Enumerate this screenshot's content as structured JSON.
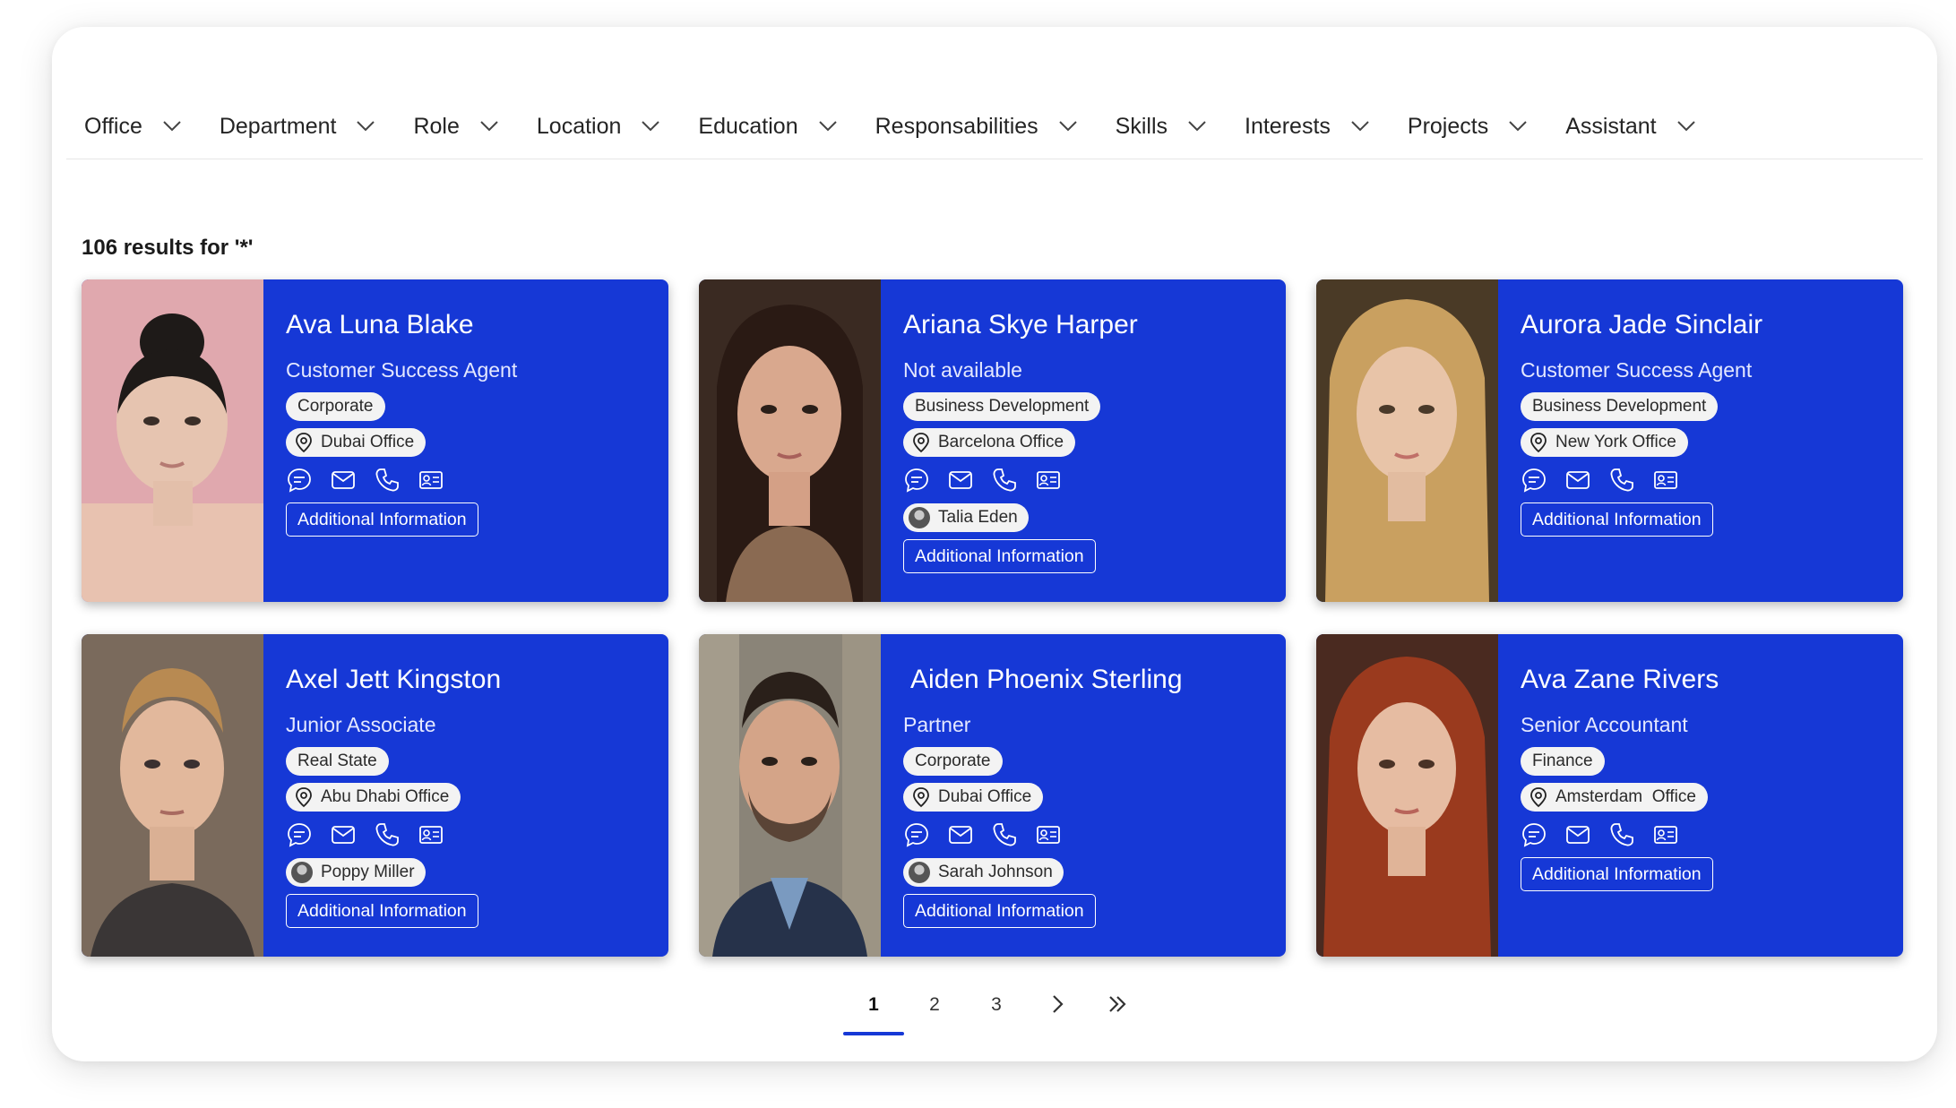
{
  "filters": [
    {
      "label": "Office"
    },
    {
      "label": "Department"
    },
    {
      "label": "Role"
    },
    {
      "label": "Location"
    },
    {
      "label": "Education"
    },
    {
      "label": "Responsabilities"
    },
    {
      "label": "Skills"
    },
    {
      "label": "Interests"
    },
    {
      "label": "Projects"
    },
    {
      "label": "Assistant"
    }
  ],
  "results_text": "106 results for '*'",
  "more_label": "Additional Information",
  "people": [
    {
      "name": "Ava Luna Blake",
      "title": "Customer Success Agent",
      "department": "Corporate",
      "office": "Dubai Office",
      "assistant": ""
    },
    {
      "name": "Ariana Skye Harper",
      "title": "Not available",
      "department": "Business Development",
      "office": "Barcelona Office",
      "assistant": "Talia Eden"
    },
    {
      "name": "Aurora Jade Sinclair",
      "title": "Customer Success Agent",
      "department": "Business Development",
      "office": "New York Office",
      "assistant": ""
    },
    {
      "name": "Axel Jett Kingston",
      "title": "Junior Associate",
      "department": "Real State",
      "office": "Abu Dhabi Office",
      "assistant": "Poppy Miller"
    },
    {
      "name": "Aiden Phoenix Sterling",
      "title": "Partner",
      "department": "Corporate",
      "office": "Dubai Office",
      "assistant": "Sarah Johnson"
    },
    {
      "name": "Ava Zane Rivers",
      "title": "Senior Accountant",
      "department": "Finance",
      "office": "Amsterdam  Office",
      "assistant": ""
    }
  ],
  "pagination": {
    "pages": [
      "1",
      "2",
      "3"
    ],
    "current": "1"
  },
  "colors": {
    "card_bg": "#1638d6",
    "accent": "#1638d6",
    "pill_bg": "#f3f3f3"
  },
  "icons": [
    "chat-icon",
    "mail-icon",
    "phone-icon",
    "contact-card-icon",
    "location-pin-icon",
    "chevron-down-icon",
    "chevron-right-icon",
    "double-chevron-right-icon"
  ]
}
